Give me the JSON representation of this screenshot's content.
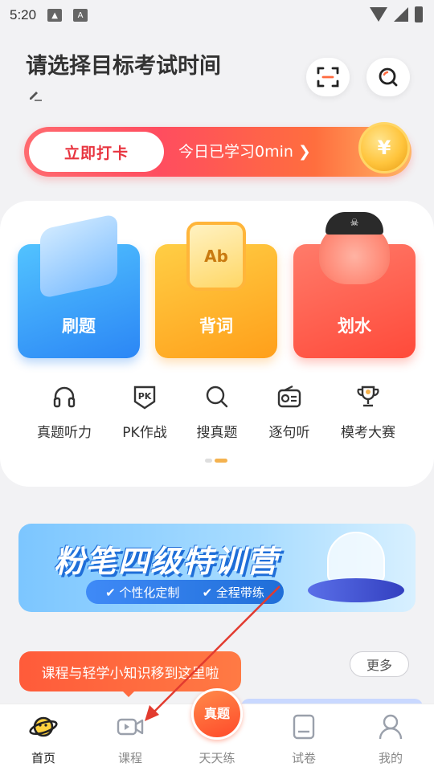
{
  "status_bar": {
    "time": "5:20"
  },
  "header": {
    "title": "请选择目标考试时间"
  },
  "checkin": {
    "button_label": "立即打卡",
    "today_text": "今日已学习0min ❯",
    "coin_symbol": "¥"
  },
  "features": [
    {
      "label": "刷题",
      "icon": "book-icon"
    },
    {
      "label": "背词",
      "icon": "vocab-card-icon",
      "art_text": "Ab"
    },
    {
      "label": "划水",
      "icon": "pirate-octopus-icon"
    }
  ],
  "shortcuts": [
    {
      "label": "真题听力",
      "icon": "headphones-icon"
    },
    {
      "label": "PK作战",
      "icon": "pk-shield-icon",
      "icon_text": "PK"
    },
    {
      "label": "搜真题",
      "icon": "search-icon"
    },
    {
      "label": "逐句听",
      "icon": "radio-icon"
    },
    {
      "label": "模考大赛",
      "icon": "trophy-icon"
    }
  ],
  "promo": {
    "title": "粉笔四级特训营",
    "tag1": "个性化定制",
    "tag2": "全程带练"
  },
  "section": {
    "more_label": "更多",
    "tooltip": "课程与轻学小知识移到这里啦"
  },
  "tabs": [
    {
      "label": "首页",
      "icon": "planet-icon",
      "active": true
    },
    {
      "label": "课程",
      "icon": "video-icon"
    },
    {
      "label": "天天练",
      "icon": "daily-practice-icon",
      "badge": "真题"
    },
    {
      "label": "试卷",
      "icon": "paper-icon"
    },
    {
      "label": "我的",
      "icon": "user-icon"
    }
  ],
  "colors": {
    "accent_red": "#e8343f",
    "accent_orange": "#ff6a3f",
    "tab_active": "#222222",
    "tab_inactive": "#888888"
  }
}
